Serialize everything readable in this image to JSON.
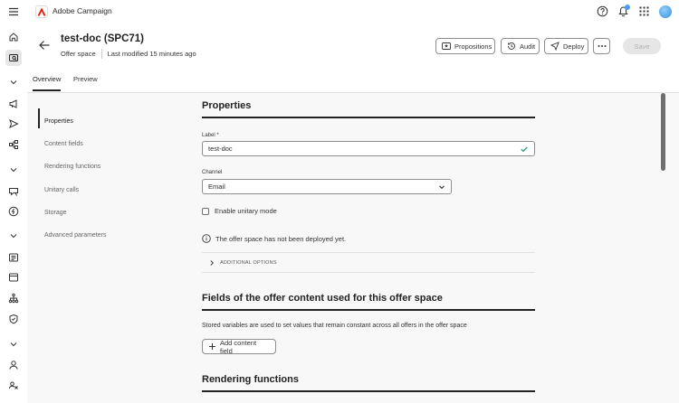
{
  "app": {
    "title": "Adobe Campaign"
  },
  "header": {
    "title": "test-doc (SPC71)",
    "subtitle_type": "Offer space",
    "subtitle_modified": "Last modified 15 minutes ago",
    "buttons": {
      "propositions": "Propositions",
      "audit": "Audit",
      "deploy": "Deploy",
      "save": "Save"
    }
  },
  "tabs": [
    {
      "label": "Overview",
      "active": true
    },
    {
      "label": "Preview",
      "active": false
    }
  ],
  "leftnav": [
    {
      "label": "Properties",
      "active": true
    },
    {
      "label": "Content fields"
    },
    {
      "label": "Rendering functions"
    },
    {
      "label": "Unitary calls"
    },
    {
      "label": "Storage"
    },
    {
      "label": "Advanced parameters"
    }
  ],
  "properties": {
    "heading": "Properties",
    "label_field": {
      "label": "Label *",
      "value": "test-doc"
    },
    "channel_field": {
      "label": "Channel",
      "value": "Email"
    },
    "unitary_checkbox": "Enable unitary mode",
    "info_text": "The offer space has not been deployed yet.",
    "additional_options": "ADDITIONAL OPTIONS"
  },
  "fields_section": {
    "heading": "Fields of the offer content used for this offer space",
    "description": "Stored variables are used to set values that remain constant across all offers in the offer space",
    "add_button": "Add content field"
  },
  "rendering_section": {
    "heading": "Rendering functions"
  },
  "colors": {
    "accent_check": "#2d9d78",
    "logo_red": "#eb1000",
    "notification": "#4b9cf5"
  }
}
